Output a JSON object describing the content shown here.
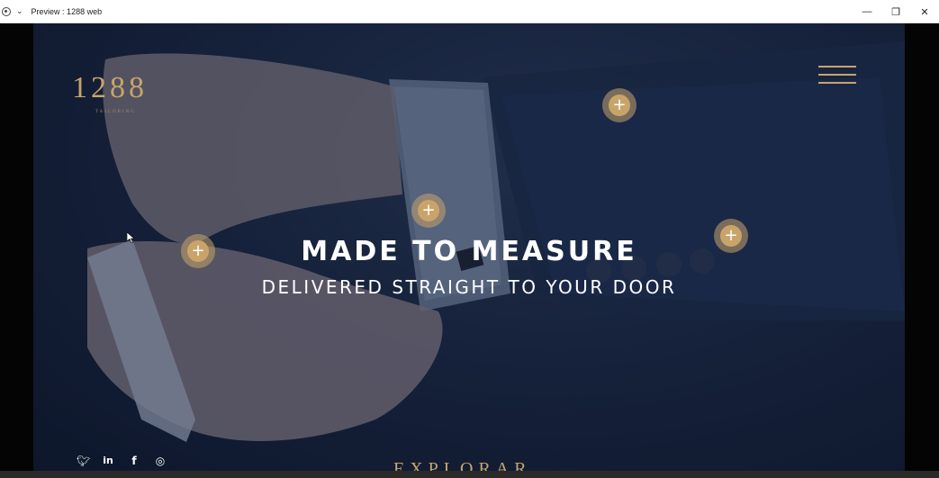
{
  "window": {
    "title": "Preview : 1288 web",
    "controls": {
      "minimize": "—",
      "maximize": "❐",
      "close": "✕"
    }
  },
  "hero": {
    "logo": {
      "number": "1288",
      "subtitle": "TAILORING"
    },
    "headline": "MADE TO MEASURE",
    "subheadline": "DELIVERED STRAIGHT TO YOUR DOOR",
    "hotspot_symbol": "+",
    "hotspot_count": 4,
    "footer_word": "EXPLORAR",
    "social": [
      {
        "name": "twitter-icon",
        "glyph": "🐦︎"
      },
      {
        "name": "linkedin-icon",
        "glyph": "in"
      },
      {
        "name": "facebook-icon",
        "glyph": "f"
      },
      {
        "name": "instagram-icon",
        "glyph": "◎"
      }
    ]
  },
  "colors": {
    "accent_gold": "#c9a46a",
    "overlay_navy": "#1b2740",
    "text_white": "#ffffff"
  }
}
